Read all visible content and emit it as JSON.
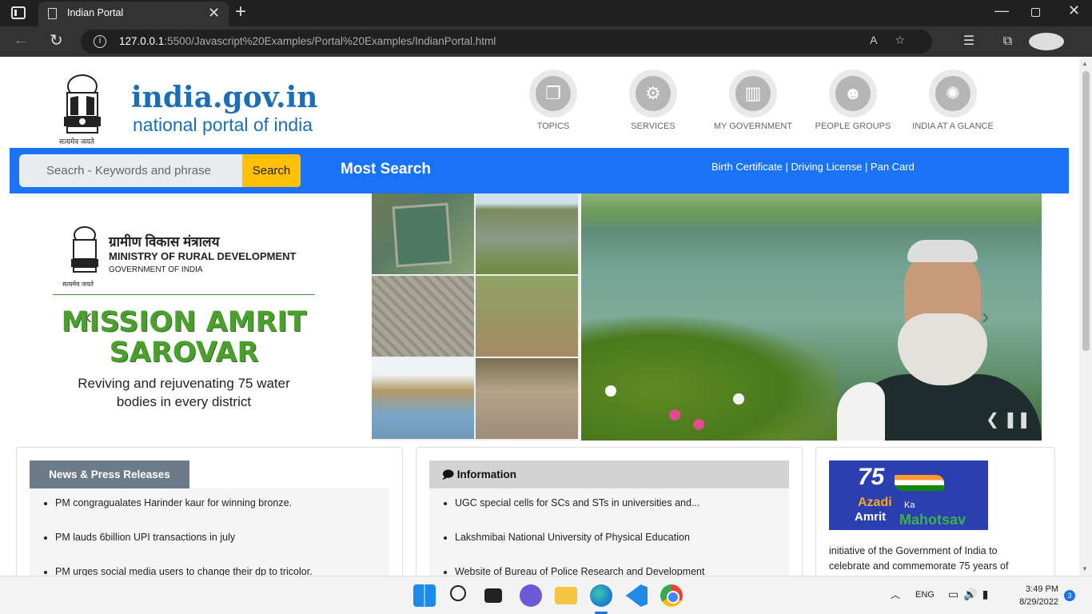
{
  "browser": {
    "tab_title": "Indian Portal",
    "url_host": "127.0.0.1",
    "url_path": ":5500/Javascript%20Examples/Portal%20Examples/IndianPortal.html"
  },
  "header": {
    "emblem_caption": "सत्यमेव जयते",
    "logo_title": "india.gov.in",
    "logo_subtitle": "national portal of india",
    "nav": [
      {
        "label": "TOPICS",
        "icon": "topics-icon"
      },
      {
        "label": "SERVICES",
        "icon": "gear-icon"
      },
      {
        "label": "MY GOVERNMENT",
        "icon": "government-icon"
      },
      {
        "label": "PEOPLE GROUPS",
        "icon": "people-icon"
      },
      {
        "label": "INDIA AT A GLANCE",
        "icon": "chakra-icon"
      }
    ]
  },
  "search": {
    "placeholder": "Seacrh - Keywords and phrase",
    "button_label": "Search",
    "most_search_label": "Most Search",
    "quick_links": "Birth Certificate | Driving License | Pan Card"
  },
  "banner": {
    "ministry_hindi": "ग्रामीण विकास मंत्रालय",
    "ministry_english": "MINISTRY OF RURAL DEVELOPMENT",
    "ministry_gov": "GOVERNMENT OF INDIA",
    "emblem_caption": "सत्यमेव जयते",
    "mission_title": "MISSION AMRIT SAROVAR",
    "mission_subtitle": "Reviving and rejuvenating 75 water bodies in every district"
  },
  "news": {
    "title": "News & Press Releases",
    "items": [
      "PM congragualates Harinder kaur for winning bronze.",
      "PM lauds 6billion UPI transactions in july",
      "PM urges social media users to change their dp to tricolor."
    ]
  },
  "information": {
    "title": "Information",
    "items": [
      "UGC special cells for SCs and STs in universities and...",
      "Lakshmibai National University of Physical Education",
      "Website of Bureau of Police Research and Development"
    ]
  },
  "azadi": {
    "number": "75",
    "word1": "Azadi",
    "word2": "Ka",
    "word3": "Amrit",
    "word4": "Mahotsav",
    "description": "initiative of the Government of India to celebrate and commemorate 75 years of"
  },
  "taskbar": {
    "language": "ENG",
    "time": "3:49 PM",
    "date": "8/29/2022",
    "notifications": "3"
  }
}
